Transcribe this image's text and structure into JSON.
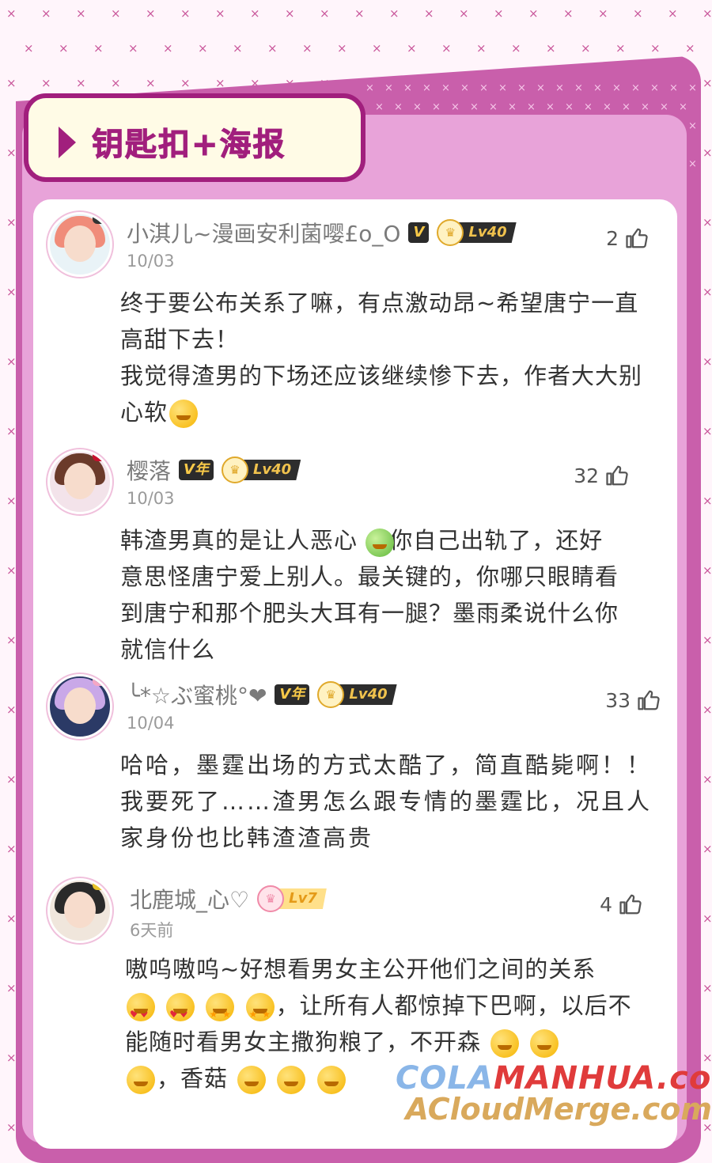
{
  "section": {
    "title": "钥匙扣+海报"
  },
  "comments": [
    {
      "username": "小淇儿~漫画安利菌嘤£o_O",
      "vip": "V",
      "level": "Lv40",
      "date": "10/03",
      "likes": "2",
      "text": "终于要公布关系了嘛，有点激动昂~希望唐宁一直高甜下去！\n我觉得渣男的下场还应该继续惨下去，作者大大别心软"
    },
    {
      "username": "樱落",
      "vip": "V年",
      "level": "Lv40",
      "date": "10/03",
      "likes": "32",
      "text": "韩渣男真的是让人恶心 ，你自己出轨了，还好意思怪唐宁爱上别人。最关键的，你哪只眼睛看到唐宁和那个肥头大耳有一腿？墨雨柔说什么你就信什么"
    },
    {
      "username": "╰*☆ぶ蜜桃°❤",
      "vip": "V年",
      "level": "Lv40",
      "date": "10/04",
      "likes": "33",
      "text": "哈哈，墨霆出场的方式太酷了，简直酷毙啊！！我要死了……渣男怎么跟专情的墨霆比，况且人家身份也比韩渣渣高贵"
    },
    {
      "username": "北鹿城_心♡",
      "vip": "",
      "level": "Lv7",
      "date": "6天前",
      "likes": "4",
      "text_parts": [
        "嗷呜嗷呜~好想看男女主公开他们之间的关系",
        "，让所有人都惊掉下巴啊，以后不能随时看男女主撒狗粮了，不开森",
        "，香菇"
      ]
    }
  ],
  "watermark": {
    "line1a": "COLA",
    "line1b": "MANHUA.com",
    "line2": "ACloudMerge.com"
  },
  "colors": {
    "accent": "#a11f7d",
    "frame": "#c95fab",
    "frame_inner": "#e8a3d9",
    "background": "#fff5fb"
  },
  "icons": {
    "like": "thumb-up-icon",
    "arrow": "play-triangle-icon"
  }
}
